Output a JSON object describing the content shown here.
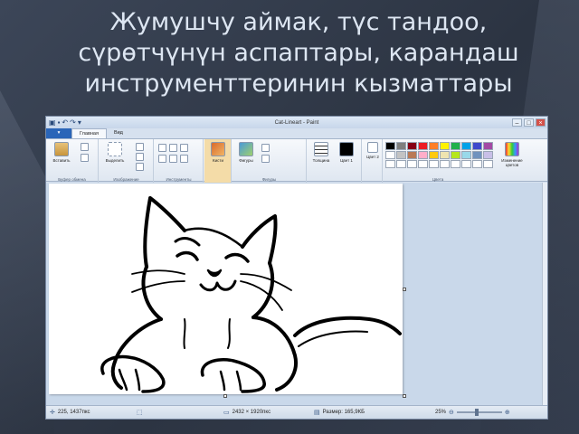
{
  "slide": {
    "title": "Жумушчу аймак, түс тандоо, сүрөтчүнүн аспаптары, карандаш инструменттеринин кызматтары"
  },
  "window": {
    "title": "Cat-Lineart - Paint"
  },
  "tabs": [
    "Главная",
    "Вид"
  ],
  "ribbon": {
    "paste_label": "Вставить",
    "select_label": "Выделить",
    "brushes_label": "Кисти",
    "shapes_label": "Фигуры",
    "thickness_label": "Толщина",
    "color1_label": "Цвет 1",
    "color2_label": "Цвет 2",
    "edit_colors_label": "Изменение цветов",
    "groups": {
      "clipboard": "Буфер обмена",
      "image": "Изображение",
      "tools": "Инструменты",
      "shapes": "Фигуры",
      "colors": "Цвета"
    }
  },
  "palette_colors": [
    "#000000",
    "#7f7f7f",
    "#880015",
    "#ed1c24",
    "#ff7f27",
    "#fff200",
    "#22b14c",
    "#00a2e8",
    "#3f48cc",
    "#a349a4",
    "#ffffff",
    "#c3c3c3",
    "#b97a57",
    "#ffaec9",
    "#ffc90e",
    "#efe4b0",
    "#b5e61d",
    "#99d9ea",
    "#7092be",
    "#c8bfe7",
    "#ffffff",
    "#ffffff",
    "#ffffff",
    "#ffffff",
    "#ffffff",
    "#ffffff",
    "#ffffff",
    "#ffffff",
    "#ffffff",
    "#ffffff"
  ],
  "statusbar": {
    "cursor_pos": "225, 1437пкс",
    "image_size": "2432 × 1920пкс",
    "file_size": "Размер: 165,9КБ",
    "zoom": "25%"
  }
}
